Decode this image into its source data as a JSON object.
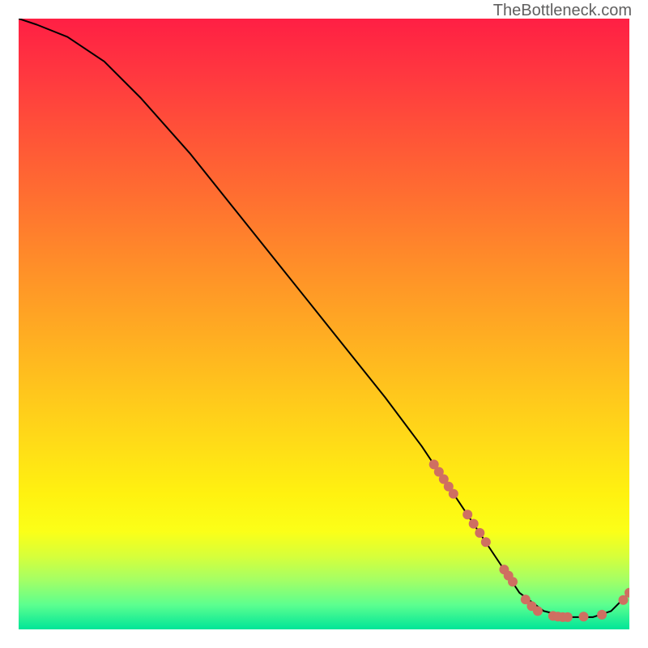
{
  "watermark": "TheBottleneck.com",
  "gradient_stops": [
    {
      "offset": 0.0,
      "color": "#ff1f44"
    },
    {
      "offset": 0.1,
      "color": "#ff3a3f"
    },
    {
      "offset": 0.2,
      "color": "#ff5637"
    },
    {
      "offset": 0.3,
      "color": "#ff7130"
    },
    {
      "offset": 0.4,
      "color": "#ff8d29"
    },
    {
      "offset": 0.5,
      "color": "#ffa823"
    },
    {
      "offset": 0.6,
      "color": "#ffc31d"
    },
    {
      "offset": 0.7,
      "color": "#ffdd17"
    },
    {
      "offset": 0.78,
      "color": "#fff210"
    },
    {
      "offset": 0.84,
      "color": "#fbff18"
    },
    {
      "offset": 0.88,
      "color": "#d7ff3a"
    },
    {
      "offset": 0.92,
      "color": "#a3ff66"
    },
    {
      "offset": 0.96,
      "color": "#5cff8f"
    },
    {
      "offset": 1.0,
      "color": "#00e598"
    }
  ],
  "chart_data": {
    "type": "line",
    "title": "",
    "xlabel": "",
    "ylabel": "",
    "xlim": [
      0,
      100
    ],
    "ylim": [
      0,
      100
    ],
    "x": [
      0,
      3,
      8,
      14,
      20,
      28,
      36,
      44,
      52,
      60,
      66,
      70,
      74,
      78,
      82,
      86,
      90,
      94,
      97,
      100
    ],
    "y": [
      100,
      99,
      97,
      93,
      87,
      78,
      68,
      58,
      48,
      38,
      30,
      24,
      18,
      12,
      6,
      3,
      2,
      2,
      3,
      6
    ],
    "markers": [
      {
        "x": 68.0,
        "y": 27.0
      },
      {
        "x": 68.8,
        "y": 25.8
      },
      {
        "x": 69.6,
        "y": 24.6
      },
      {
        "x": 70.4,
        "y": 23.4
      },
      {
        "x": 71.2,
        "y": 22.2
      },
      {
        "x": 73.5,
        "y": 18.8
      },
      {
        "x": 74.5,
        "y": 17.3
      },
      {
        "x": 75.5,
        "y": 15.8
      },
      {
        "x": 76.5,
        "y": 14.3
      },
      {
        "x": 79.5,
        "y": 9.8
      },
      {
        "x": 80.2,
        "y": 8.8
      },
      {
        "x": 80.9,
        "y": 7.8
      },
      {
        "x": 83.0,
        "y": 4.9
      },
      {
        "x": 84.0,
        "y": 3.8
      },
      {
        "x": 85.0,
        "y": 3.0
      },
      {
        "x": 87.5,
        "y": 2.2
      },
      {
        "x": 88.3,
        "y": 2.1
      },
      {
        "x": 89.1,
        "y": 2.0
      },
      {
        "x": 89.9,
        "y": 2.0
      },
      {
        "x": 92.5,
        "y": 2.1
      },
      {
        "x": 95.5,
        "y": 2.4
      },
      {
        "x": 99.0,
        "y": 4.8
      },
      {
        "x": 100.0,
        "y": 6.0
      }
    ],
    "marker_color": "#cf6f61",
    "line_color": "#000000"
  }
}
